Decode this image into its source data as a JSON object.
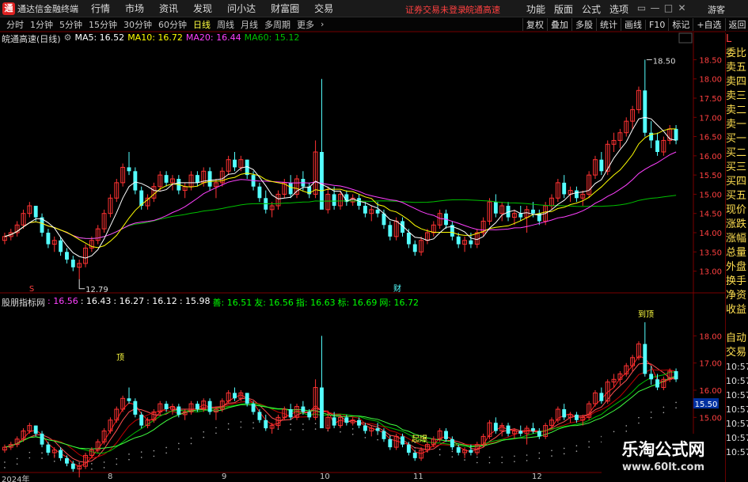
{
  "titlebar": {
    "logo": "通",
    "app_name": "通达信金融终端",
    "menus": [
      "行情",
      "市场",
      "资讯",
      "发现",
      "问小达",
      "财富圈",
      "交易"
    ],
    "login_status": "证券交易未登录",
    "stock_name": "皖通高速",
    "right_menus": [
      "功能",
      "版面",
      "公式",
      "选项"
    ],
    "window_controls": [
      "▭",
      "—",
      "□",
      "✕"
    ],
    "user": "游客"
  },
  "periodbar": {
    "periods": [
      "分时",
      "1分钟",
      "5分钟",
      "15分钟",
      "30分钟",
      "60分钟",
      "日线",
      "周线",
      "月线",
      "多周期",
      "更多"
    ],
    "active": "日线",
    "tools": [
      "复权",
      "叠加",
      "多股",
      "统计",
      "画线",
      "F10",
      "标记",
      "+自选",
      "返回"
    ]
  },
  "main_header": {
    "title": "皖通高速(日线)",
    "ma5": "MA5: 16.52",
    "ma10": "MA10: 16.72",
    "ma20": "MA20: 16.44",
    "ma60": "MA60: 15.12"
  },
  "sub_header": {
    "title": "股朋指标网",
    "v1": ": 16.56",
    "v2": ": 16.43",
    "v3": ": 16.27",
    "v4": ": 16.12",
    "v5": ": 15.98",
    "shan": "善: 16.51",
    "you": "友: 16.56",
    "zhi": "指: 16.63",
    "biao": "标: 16.69",
    "wang": "网: 16.72"
  },
  "main_yaxis": [
    "18.50",
    "18.00",
    "17.50",
    "17.00",
    "16.50",
    "16.00",
    "15.50",
    "15.00",
    "14.50",
    "14.00",
    "13.50",
    "13.00"
  ],
  "sub_yaxis": [
    "18.00",
    "17.00",
    "16.00",
    "15.00"
  ],
  "sub_current_price": "15.50",
  "annotations": {
    "high": "18.50",
    "low": "12.79",
    "cai": "财",
    "s": "S",
    "ding": "顶",
    "ding2": "到顶",
    "qidong": "起爆"
  },
  "side_panel": [
    "L",
    "委比",
    "卖五",
    "卖四",
    "卖三",
    "卖二",
    "卖一",
    "买一",
    "买二",
    "买三",
    "买四",
    "买五",
    "现价",
    "涨跌",
    "涨幅",
    "总量",
    "外盘",
    "换手",
    "净资",
    "收益",
    "",
    "自动",
    "交易",
    "10:57",
    "10:57",
    "10:57",
    "10:57",
    "10:57",
    "10:57",
    "10:57"
  ],
  "x_axis": [
    "2024年",
    "8",
    "9",
    "10",
    "11",
    "12"
  ],
  "watermark": {
    "title": "乐淘公式网",
    "url": "www.60lt.com"
  },
  "colors": {
    "up": "#ff3232",
    "down": "#54ffff",
    "ma5": "#ffffff",
    "ma10": "#ffff00",
    "ma20": "#ff40ff",
    "ma60": "#00c000",
    "grid": "#7a0000",
    "axis_text": "#ff4040"
  },
  "chart_data": {
    "type": "candlestick",
    "title": "皖通高速(日线)",
    "ylim": [
      12.6,
      18.9
    ],
    "x_labels": [
      "2024年",
      "8",
      "9",
      "10",
      "11",
      "12"
    ],
    "ohlc": [
      [
        13.8,
        14.0,
        13.7,
        13.9
      ],
      [
        13.9,
        14.1,
        13.8,
        14.0
      ],
      [
        14.0,
        14.3,
        13.9,
        14.2
      ],
      [
        14.2,
        14.6,
        14.1,
        14.5
      ],
      [
        14.5,
        14.8,
        14.4,
        14.7
      ],
      [
        14.7,
        14.7,
        14.3,
        14.4
      ],
      [
        14.4,
        14.5,
        13.9,
        14.0
      ],
      [
        14.0,
        14.1,
        13.6,
        13.7
      ],
      [
        13.7,
        13.9,
        13.5,
        13.8
      ],
      [
        13.8,
        13.9,
        13.4,
        13.5
      ],
      [
        13.5,
        13.6,
        13.2,
        13.3
      ],
      [
        13.3,
        13.4,
        13.0,
        13.1
      ],
      [
        13.1,
        13.3,
        12.79,
        13.2
      ],
      [
        13.2,
        13.7,
        13.1,
        13.6
      ],
      [
        13.6,
        13.9,
        13.5,
        13.8
      ],
      [
        13.8,
        14.2,
        13.7,
        14.1
      ],
      [
        14.1,
        14.6,
        14.0,
        14.5
      ],
      [
        14.5,
        15.0,
        14.4,
        14.9
      ],
      [
        14.9,
        15.4,
        14.8,
        15.3
      ],
      [
        15.3,
        15.8,
        15.2,
        15.7
      ],
      [
        15.7,
        16.1,
        15.5,
        15.6
      ],
      [
        15.6,
        15.7,
        15.0,
        15.1
      ],
      [
        15.1,
        15.2,
        14.6,
        14.7
      ],
      [
        14.7,
        15.0,
        14.6,
        14.9
      ],
      [
        14.9,
        15.3,
        14.8,
        15.2
      ],
      [
        15.2,
        15.6,
        15.1,
        15.5
      ],
      [
        15.5,
        15.6,
        15.2,
        15.3
      ],
      [
        15.3,
        15.5,
        15.1,
        15.4
      ],
      [
        15.4,
        15.5,
        15.0,
        15.1
      ],
      [
        15.1,
        15.3,
        14.9,
        15.2
      ],
      [
        15.2,
        15.6,
        15.1,
        15.5
      ],
      [
        15.5,
        15.6,
        15.2,
        15.3
      ],
      [
        15.3,
        15.7,
        15.2,
        15.6
      ],
      [
        15.6,
        15.7,
        15.1,
        15.2
      ],
      [
        15.2,
        15.4,
        14.9,
        15.3
      ],
      [
        15.3,
        15.7,
        15.2,
        15.6
      ],
      [
        15.6,
        16.0,
        15.5,
        15.9
      ],
      [
        15.9,
        16.1,
        15.6,
        15.7
      ],
      [
        15.7,
        16.0,
        15.6,
        15.9
      ],
      [
        15.9,
        15.9,
        15.4,
        15.5
      ],
      [
        15.5,
        15.6,
        15.1,
        15.2
      ],
      [
        15.2,
        15.3,
        14.8,
        14.9
      ],
      [
        14.9,
        15.1,
        14.5,
        14.6
      ],
      [
        14.6,
        14.8,
        14.4,
        14.7
      ],
      [
        14.7,
        15.1,
        14.6,
        15.0
      ],
      [
        15.0,
        15.4,
        14.9,
        15.3
      ],
      [
        15.3,
        15.5,
        14.9,
        15.0
      ],
      [
        15.0,
        15.5,
        14.9,
        15.4
      ],
      [
        15.4,
        15.6,
        15.1,
        15.2
      ],
      [
        15.2,
        15.3,
        14.9,
        15.0
      ],
      [
        15.0,
        16.4,
        14.9,
        16.1
      ],
      [
        16.1,
        18.0,
        15.3,
        14.6
      ],
      [
        14.6,
        15.2,
        14.5,
        15.0
      ],
      [
        15.0,
        15.2,
        14.6,
        14.7
      ],
      [
        14.7,
        15.1,
        14.6,
        15.0
      ],
      [
        15.0,
        15.1,
        14.7,
        14.8
      ],
      [
        14.8,
        15.0,
        14.7,
        14.9
      ],
      [
        14.9,
        15.0,
        14.6,
        14.7
      ],
      [
        14.7,
        14.8,
        14.4,
        14.5
      ],
      [
        14.5,
        14.7,
        14.3,
        14.6
      ],
      [
        14.6,
        14.8,
        14.4,
        14.5
      ],
      [
        14.5,
        14.6,
        14.1,
        14.2
      ],
      [
        14.2,
        14.3,
        13.8,
        13.9
      ],
      [
        13.9,
        14.4,
        13.8,
        14.3
      ],
      [
        14.3,
        14.4,
        13.9,
        14.0
      ],
      [
        14.0,
        14.1,
        13.6,
        13.7
      ],
      [
        13.7,
        13.8,
        13.4,
        13.5
      ],
      [
        13.5,
        13.9,
        13.4,
        13.8
      ],
      [
        13.8,
        14.1,
        13.7,
        14.0
      ],
      [
        14.0,
        14.3,
        13.9,
        14.2
      ],
      [
        14.2,
        14.6,
        14.1,
        14.5
      ],
      [
        14.5,
        14.6,
        14.1,
        14.2
      ],
      [
        14.2,
        14.3,
        13.8,
        13.9
      ],
      [
        13.9,
        14.0,
        13.6,
        13.7
      ],
      [
        13.7,
        13.9,
        13.5,
        13.8
      ],
      [
        13.8,
        14.0,
        13.6,
        13.7
      ],
      [
        13.7,
        14.1,
        13.6,
        14.0
      ],
      [
        14.0,
        14.4,
        13.9,
        14.3
      ],
      [
        14.3,
        14.9,
        14.2,
        14.8
      ],
      [
        14.8,
        15.0,
        14.4,
        14.5
      ],
      [
        14.5,
        14.8,
        14.3,
        14.7
      ],
      [
        14.7,
        14.8,
        14.3,
        14.4
      ],
      [
        14.4,
        14.6,
        14.2,
        14.5
      ],
      [
        14.5,
        14.7,
        14.3,
        14.4
      ],
      [
        14.4,
        14.7,
        14.0,
        14.6
      ],
      [
        14.6,
        14.8,
        14.4,
        14.5
      ],
      [
        14.5,
        14.6,
        14.2,
        14.3
      ],
      [
        14.3,
        14.8,
        14.2,
        14.7
      ],
      [
        14.7,
        15.0,
        14.6,
        14.9
      ],
      [
        14.9,
        15.4,
        14.8,
        15.3
      ],
      [
        15.3,
        15.5,
        14.9,
        15.0
      ],
      [
        15.0,
        15.2,
        14.8,
        15.1
      ],
      [
        15.1,
        15.2,
        14.8,
        14.9
      ],
      [
        14.9,
        15.1,
        14.7,
        15.0
      ],
      [
        15.0,
        15.6,
        14.9,
        15.5
      ],
      [
        15.5,
        16.0,
        15.4,
        15.9
      ],
      [
        15.9,
        16.1,
        15.5,
        15.6
      ],
      [
        15.6,
        16.4,
        15.5,
        16.3
      ],
      [
        16.3,
        16.6,
        16.1,
        16.4
      ],
      [
        16.4,
        16.7,
        16.2,
        16.6
      ],
      [
        16.6,
        17.0,
        16.5,
        16.9
      ],
      [
        16.9,
        17.3,
        16.7,
        17.2
      ],
      [
        17.2,
        17.8,
        17.1,
        17.7
      ],
      [
        17.7,
        18.5,
        16.5,
        16.6
      ],
      [
        16.6,
        16.9,
        16.2,
        16.4
      ],
      [
        16.4,
        16.6,
        16.0,
        16.1
      ],
      [
        16.1,
        16.5,
        16.0,
        16.4
      ],
      [
        16.4,
        16.8,
        16.3,
        16.7
      ],
      [
        16.7,
        16.8,
        16.3,
        16.4
      ]
    ]
  }
}
